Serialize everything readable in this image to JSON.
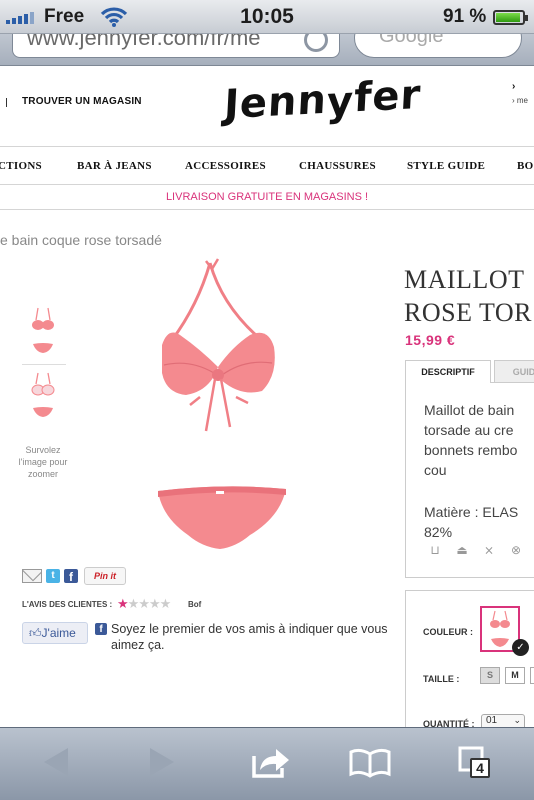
{
  "status_bar": {
    "carrier": "Free",
    "time": "10:05",
    "battery_percent": "91 %",
    "battery_level": 0.91
  },
  "browser": {
    "url_text": "www.jennyfer.com/fr/me",
    "search_placeholder": "Google",
    "tab_count": "4"
  },
  "header": {
    "store_link": "TROUVER UN MAGASIN",
    "logo_text_a": "Jenn",
    "logo_text_b": "y",
    "logo_text_c": "fer",
    "account_chevron": "›",
    "account_sub": "› me"
  },
  "nav": {
    "items": [
      "CTIONS",
      "BAR À JEANS",
      "ACCESSOIRES",
      "CHAUSSURES",
      "STYLE GUIDE",
      "BO"
    ]
  },
  "promo": {
    "text": "LIVRAISON GRATUITE EN MAGASINS !"
  },
  "breadcrumb": "e bain coque rose torsadé",
  "gallery": {
    "zoom_hint": "Survolez l'image pour zoomer"
  },
  "product": {
    "title_line1": "MAILLOT",
    "title_line2": "ROSE TOR",
    "price": "15,99 €",
    "tabs": [
      "DESCRIPTIF",
      "GUID"
    ],
    "description": "Maillot de bain\ntorsade au cre\nbonnets rembo\ncou",
    "material": "Matière : ELAS\n82%",
    "options": {
      "color_label": "COULEUR :",
      "size_label": "TAILLE :",
      "sizes": [
        "S",
        "M",
        "L"
      ],
      "quantity_label": "QUANTITÉ :",
      "quantity_value": "01"
    }
  },
  "social": {
    "pin_label": "Pin it",
    "reviews_label": "L'AVIS DES CLIENTES :",
    "rating": 1,
    "rating_max": 5,
    "rating_word": "Bof",
    "like_label": "J'aime",
    "fb_text": "Soyez le premier de vos amis à indiquer que vous aimez ça."
  },
  "colors": {
    "accent_pink": "#d9337b",
    "bikini_pink": "#f48a8f",
    "facebook_blue": "#3b5998"
  }
}
